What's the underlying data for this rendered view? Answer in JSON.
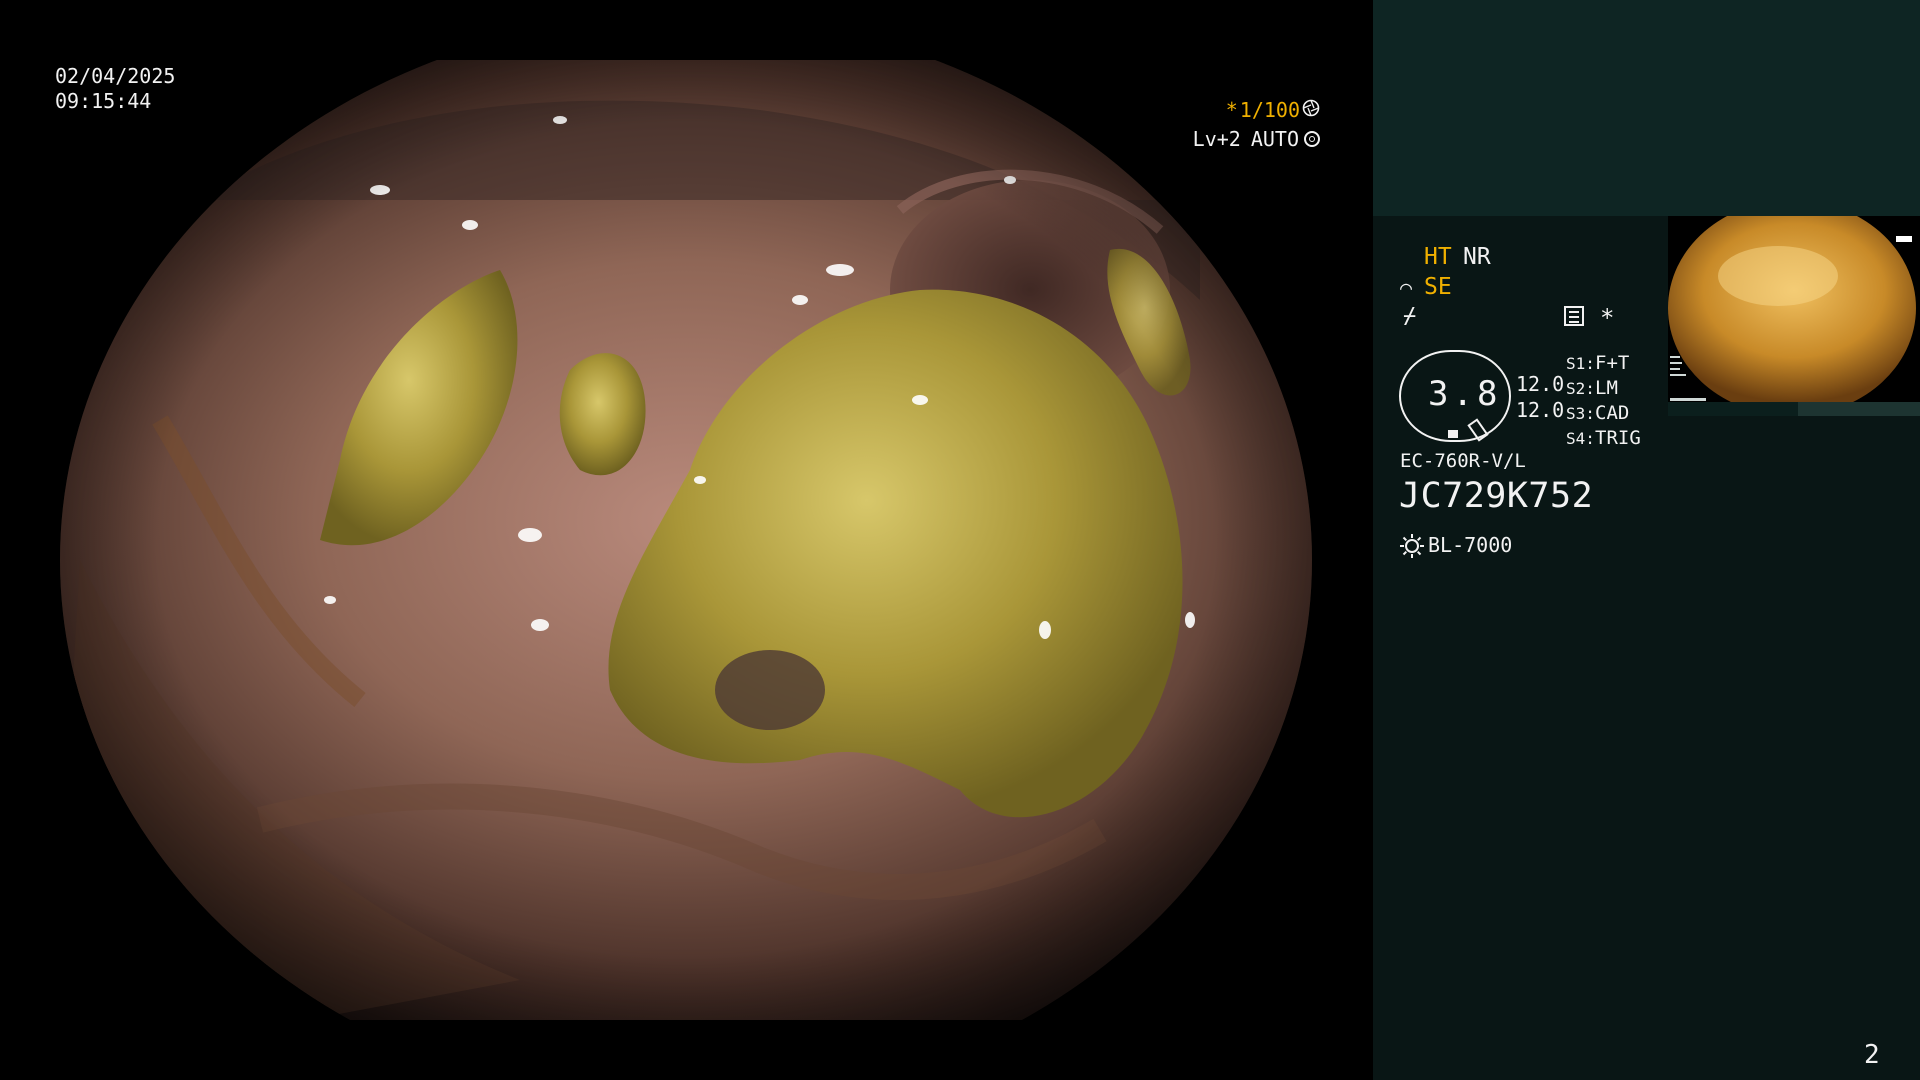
{
  "osd": {
    "date": "02/04/2025",
    "time": "09:15:44",
    "shutter_prefix": "*",
    "shutter": "1/100",
    "shutter_icon": "aperture-icon",
    "level": "Lv+2",
    "iris_mode": "AUTO",
    "iris_icon": "iris-icon"
  },
  "panel": {
    "ht": "HT",
    "nr": "NR",
    "se_icon": "⌒",
    "se": "SE",
    "flash_icon": "⌿",
    "menu_icon": "menu-icon",
    "asterisk": "*",
    "magnification": "3.8",
    "value_1": "12.0",
    "value_2": "12.0",
    "switches": [
      {
        "key": "S1:",
        "value": "F+T"
      },
      {
        "key": "S2:",
        "value": "LM"
      },
      {
        "key": "S3:",
        "value": "CAD"
      },
      {
        "key": "S4:",
        "value": "TRIG"
      }
    ],
    "scope_model": "EC-760R-V/L",
    "scope_serial": "JC729K752",
    "lamp_icon": "light-source-icon",
    "light_source": "BL-7000",
    "page_number": "2"
  },
  "colors": {
    "osd_amber": "#f0b000",
    "osd_white": "#f2f2f2",
    "panel_bg": "#091615",
    "panel_top_bg": "#0e2523"
  }
}
